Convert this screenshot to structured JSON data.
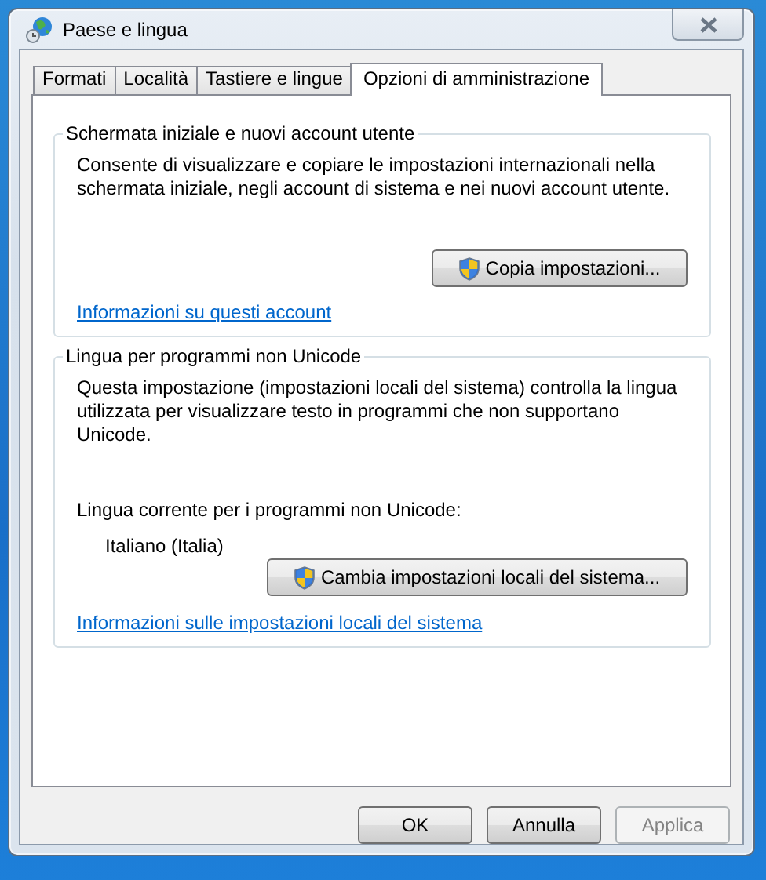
{
  "window": {
    "title": "Paese e lingua"
  },
  "tabs": [
    {
      "label": "Formati",
      "selected": false
    },
    {
      "label": "Località",
      "selected": false
    },
    {
      "label": "Tastiere e lingue",
      "selected": false
    },
    {
      "label": "Opzioni di amministrazione",
      "selected": true
    }
  ],
  "groups": [
    {
      "title": "Schermata iniziale e nuovi account utente",
      "description": "Consente di visualizzare e copiare le impostazioni internazionali nella schermata iniziale, negli account di sistema e nei nuovi account utente.",
      "button": "Copia impostazioni...",
      "link": "Informazioni su questi account"
    },
    {
      "title": "Lingua per programmi non Unicode",
      "description": "Questa impostazione (impostazioni locali del sistema) controlla la lingua utilizzata per visualizzare testo in programmi che non supportano Unicode.",
      "current_label": "Lingua corrente per i programmi non Unicode:",
      "current_value": "Italiano (Italia)",
      "button": "Cambia impostazioni locali del sistema...",
      "link": "Informazioni sulle impostazioni locali del sistema"
    }
  ],
  "buttons": [
    {
      "label": "OK",
      "disabled": false
    },
    {
      "label": "Annulla",
      "disabled": false
    },
    {
      "label": "Applica",
      "disabled": true
    }
  ]
}
